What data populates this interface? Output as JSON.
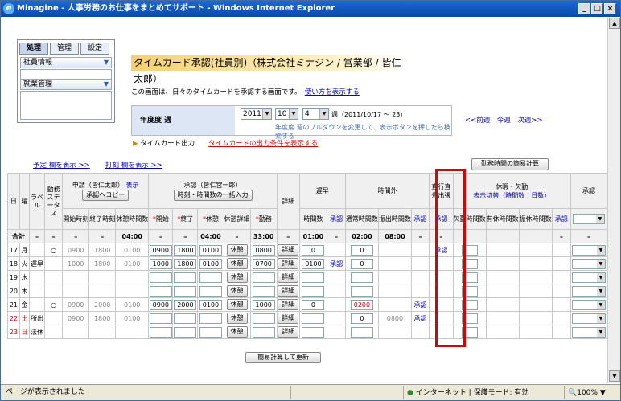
{
  "window": {
    "title": "Minagine - 人事労務のお仕事をまとめてサポート - Windows Internet Explorer"
  },
  "side": {
    "tabs": [
      "処理",
      "管理",
      "設定"
    ],
    "items": [
      "社員情報",
      "就業管理"
    ]
  },
  "header": {
    "title": "タイムカード承認(社員別)（株式会社ミナジン / 営業部 / 皆仁太郎）",
    "desc": "この画面は、日々のタイムカードを承認する画面です。",
    "howto": "使い方を表示する"
  },
  "filter": {
    "label": "年度度  週",
    "year": "2011",
    "month": "10",
    "week": "4",
    "week_text": "週（2011/10/17 〜 23）",
    "hint": "年度度  週のプルダウンを変更して、表示ボタンを押したら検索する",
    "prev": "<<前週",
    "this": "今週",
    "next": "次週>>"
  },
  "tc": {
    "label": "タイムカード出力",
    "link": "タイムカードの出力条件を表示する"
  },
  "links": {
    "plan": "予定 欄を表示 >>",
    "stamp": "打刻 欄を表示 >>"
  },
  "buttons": {
    "simple": "勤務時間の簡易計算",
    "copy": "承認へコピー",
    "bulk": "時刻・時間数の一括入力",
    "calc": "簡易計算して更新",
    "rest": "休憩",
    "detail": "詳細"
  },
  "headers": {
    "day": "日",
    "dow": "曜",
    "label": "ラベル",
    "status": "勤務ステータス",
    "apply": "申請（皆仁太郎）",
    "apply_show": "表示",
    "approve_grp": "承認（皆仁宮一郎）",
    "detail": "詳細",
    "late": "遅早",
    "overtime": "時間外",
    "direct": "直行直帰出張",
    "leave": "休暇・欠勤",
    "leave_switch": "表示切替（時間数｜日数）",
    "approve": "承認",
    "start": "開始時刻",
    "end": "終了時刻",
    "rest_t": "休憩時間数",
    "a_start": "開始",
    "a_end": "終了",
    "a_rest": "休憩",
    "rest_detail": "休憩詳細",
    "work": "勤務",
    "work_sub": "時間数",
    "hours": "時間数",
    "approve_s": "承認",
    "normal": "通常時間数",
    "transfer": "振出時間数",
    "absent": "欠勤時間数",
    "paid": "有休時間数",
    "comp": "振休時間数",
    "time": "時刻",
    "time2": "時刻"
  },
  "sum": {
    "label": "合計",
    "rest": "04:00",
    "a_rest": "04:00",
    "work": "33:00",
    "late": "01:00",
    "normal": "02:00",
    "transfer": "08:00"
  },
  "rows": [
    {
      "day": "17",
      "dow": "月",
      "label": "",
      "status": "○",
      "s": "0900",
      "e": "1800",
      "r": "0100",
      "as": "0900",
      "ae": "1800",
      "ar": "0100",
      "w": "0800",
      "late": "0",
      "late_ap": "",
      "ot": "0",
      "ot_c": "",
      "tr": "",
      "ot_ap": "",
      "dir": "承認"
    },
    {
      "day": "18",
      "dow": "火",
      "label": "遅早",
      "status": "",
      "s": "1000",
      "e": "1800",
      "r": "0100",
      "as": "1000",
      "ae": "1800",
      "ar": "0100",
      "w": "0700",
      "late": "0100",
      "late_ap": "承認",
      "ot": "0",
      "ot_c": "",
      "tr": "",
      "ot_ap": "",
      "dir": ""
    },
    {
      "day": "19",
      "dow": "水",
      "label": "",
      "status": "",
      "s": "",
      "e": "",
      "r": "",
      "as": "",
      "ae": "",
      "ar": "",
      "w": "",
      "late": "",
      "late_ap": "",
      "ot": "",
      "ot_c": "",
      "tr": "",
      "ot_ap": "",
      "dir": ""
    },
    {
      "day": "20",
      "dow": "木",
      "label": "",
      "status": "",
      "s": "",
      "e": "",
      "r": "",
      "as": "",
      "ae": "",
      "ar": "",
      "w": "",
      "late": "",
      "late_ap": "",
      "ot": "",
      "ot_c": "",
      "tr": "",
      "ot_ap": "",
      "dir": ""
    },
    {
      "day": "21",
      "dow": "金",
      "label": "",
      "status": "○",
      "s": "0900",
      "e": "2000",
      "r": "0100",
      "as": "0900",
      "ae": "2000",
      "ar": "0100",
      "w": "1000",
      "late": "0",
      "late_ap": "",
      "ot": "0200",
      "ot_c": "red",
      "tr": "",
      "ot_ap": "承認",
      "dir": ""
    },
    {
      "day": "22",
      "dow": "土",
      "label": "所出",
      "status": "",
      "s": "0900",
      "e": "1800",
      "r": "0100",
      "as": "",
      "ae": "",
      "ar": "",
      "w": "",
      "late": "",
      "late_ap": "",
      "ot": "0",
      "ot_c": "",
      "tr": "0800",
      "ot_ap": "承認",
      "dir": ""
    },
    {
      "day": "23",
      "dow": "日",
      "label": "法休",
      "status": "",
      "s": "",
      "e": "",
      "r": "",
      "as": "",
      "ae": "",
      "ar": "",
      "w": "",
      "late": "",
      "late_ap": "",
      "ot": "",
      "ot_c": "",
      "tr": "",
      "ot_ap": "",
      "dir": ""
    }
  ],
  "status": {
    "text": "ページが表示されました",
    "zone": "インターネット | 保護モード: 有効",
    "zoom": "100%"
  }
}
